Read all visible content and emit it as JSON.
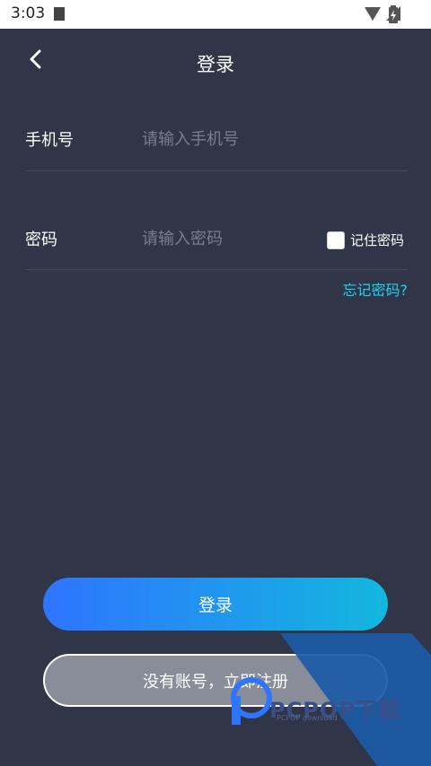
{
  "status_bar": {
    "time": "3:03",
    "icons": [
      "notification-icon",
      "wifi-icon",
      "signal-icon",
      "battery-icon"
    ]
  },
  "nav": {
    "back_icon": "chevron-left-icon",
    "title": "登录"
  },
  "form": {
    "phone": {
      "label": "手机号",
      "placeholder": "请输入手机号",
      "value": ""
    },
    "password": {
      "label": "密码",
      "placeholder": "请输入密码",
      "value": ""
    },
    "remember": {
      "label": "记住密码",
      "checked": false
    },
    "forgot_link": "忘记密码?"
  },
  "actions": {
    "login_label": "登录",
    "register_label": "没有账号，立即注册"
  },
  "watermark": {
    "text": "PCPOP下载",
    "subtext": "PCPOP download"
  },
  "colors": {
    "background": "#313548",
    "accent_link": "#1ed2f0",
    "login_gradient_start": "#2f74ff",
    "login_gradient_end": "#13b7de",
    "register_fill": "#898c99",
    "watermark_blue": "#1b5aa6"
  }
}
